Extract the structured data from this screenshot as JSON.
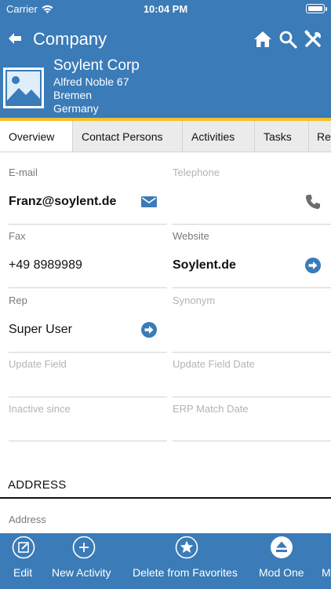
{
  "status": {
    "carrier": "Carrier",
    "time": "10:04 PM"
  },
  "nav": {
    "title": "Company"
  },
  "company": {
    "name": "Soylent Corp",
    "street": "Alfred Noble 67",
    "city": "Bremen",
    "country": "Germany"
  },
  "tabs": [
    {
      "label": "Overview"
    },
    {
      "label": "Contact Persons"
    },
    {
      "label": "Activities"
    },
    {
      "label": "Tasks"
    },
    {
      "label": "Re"
    }
  ],
  "fields": {
    "email": {
      "label": "E-mail",
      "value": "Franz@soylent.de"
    },
    "telephone": {
      "label": "Telephone",
      "value": ""
    },
    "fax": {
      "label": "Fax",
      "value": "+49 8989989"
    },
    "website": {
      "label": "Website",
      "value": "Soylent.de"
    },
    "rep": {
      "label": "Rep",
      "value": "Super User"
    },
    "synonym": {
      "label": "Synonym",
      "value": ""
    },
    "update_field": {
      "label": "Update Field",
      "value": ""
    },
    "update_field_date": {
      "label": "Update Field Date",
      "value": ""
    },
    "inactive_since": {
      "label": "Inactive since",
      "value": ""
    },
    "erp_match_date": {
      "label": "ERP Match Date",
      "value": ""
    }
  },
  "address_section": {
    "title": "ADDRESS",
    "address_label": "Address"
  },
  "toolbar": {
    "edit": "Edit",
    "new_activity": "New Activity",
    "delete_favorites": "Delete from Favorites",
    "mod_one": "Mod One",
    "more": "M"
  },
  "colors": {
    "primary": "#3a7bb8",
    "accent": "#f2c12e",
    "icon_blue": "#3a7bb8"
  }
}
